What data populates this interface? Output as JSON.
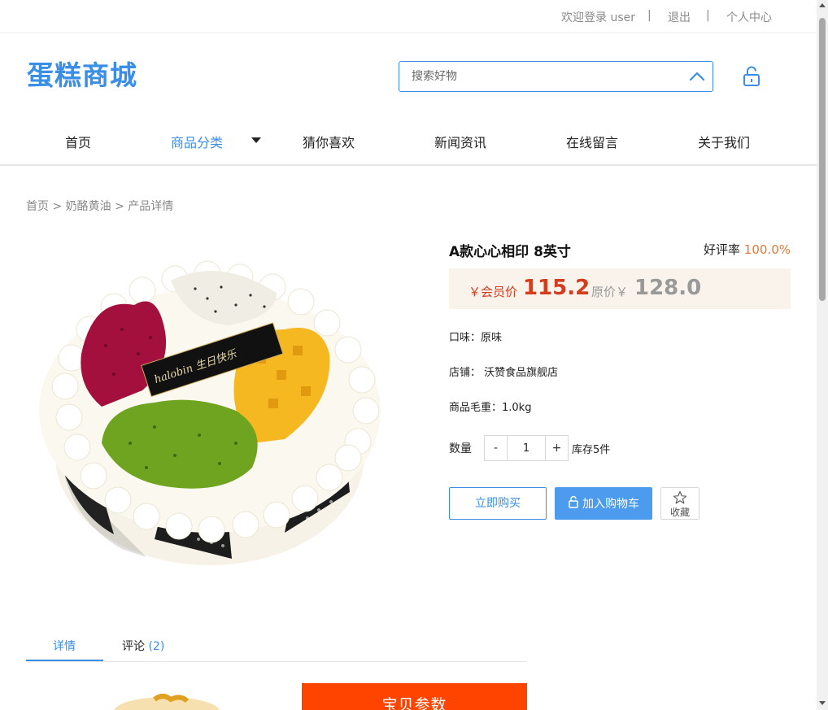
{
  "topbar": {
    "welcome": "欢迎登录 user",
    "sep1": "|",
    "logout": "退出",
    "sep2": "|",
    "user_center": "个人中心"
  },
  "header": {
    "logo": "蛋糕商城",
    "search_placeholder": "搜索好物",
    "search_icon": "chevron-up-icon",
    "lock_icon": "unlock-icon"
  },
  "nav": {
    "items": [
      "首页",
      "商品分类",
      "猜你喜欢",
      "新闻资讯",
      "在线留言",
      "关于我们"
    ],
    "active": "商品分类"
  },
  "breadcrumb": "首页 > 奶酪黄油 > 产品详情",
  "product": {
    "title": "A款心心相印 8英寸",
    "rating_label": "好评率",
    "rating_value": "100.0%",
    "member_price_label": "￥会员价",
    "member_price": "115.2",
    "original_price_label": "原价￥",
    "original_price": "128.0",
    "flavor": "口味：原味",
    "shop": "店铺：  沃赞食品旗舰店",
    "weight": "商品毛重：1.0kg",
    "quantity_label": "数量",
    "quantity_minus": "-",
    "quantity_value": "1",
    "quantity_plus": "+",
    "stock": "库存5件",
    "buy_now": "立即购买",
    "add_to_cart": "加入购物车",
    "favorite": "收藏",
    "cake_topper_text": "halobin 生日快乐"
  },
  "tabs": {
    "detail": "详情",
    "comments": "评论",
    "comments_count": "(2)"
  },
  "detail_section": {
    "params_heading": "宝贝参数"
  },
  "colors": {
    "accent": "#3a8ee6",
    "price_red": "#d43c1e",
    "rating_orange": "#e07a3a",
    "params_orange": "#ff4400"
  }
}
